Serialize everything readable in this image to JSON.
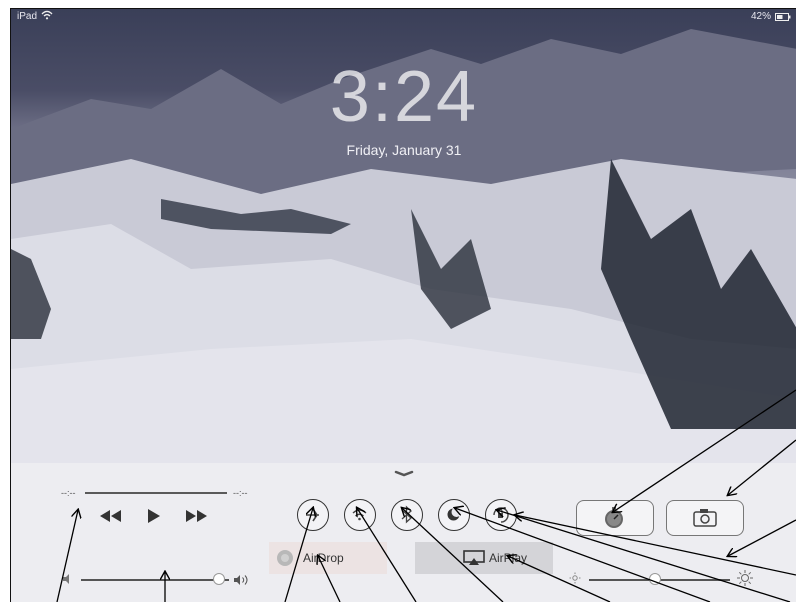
{
  "status_bar": {
    "device": "iPad",
    "battery": "42%"
  },
  "lock_screen": {
    "time": "3:24",
    "date": "Friday, January 31"
  },
  "control_center": {
    "elapsed": "--:--",
    "remaining": "--:--",
    "airdrop_label": "AirDrop",
    "airplay_label": "AirPlay",
    "volume_level": 0.93,
    "brightness_level": 0.47
  },
  "icons": [
    "wifi-icon",
    "battery-icon",
    "rewind-icon",
    "play-icon",
    "fast-forward-icon",
    "airplane-mode-icon",
    "wifi-toggle-icon",
    "bluetooth-icon",
    "moon-icon",
    "rotation-lock-icon",
    "timer-icon",
    "camera-icon",
    "volume-low-icon",
    "volume-high-icon",
    "brightness-low-icon",
    "brightness-high-icon",
    "airdrop-icon",
    "airplay-icon"
  ],
  "colors": {
    "panel": "#ececf0",
    "arrow": "#000000"
  }
}
